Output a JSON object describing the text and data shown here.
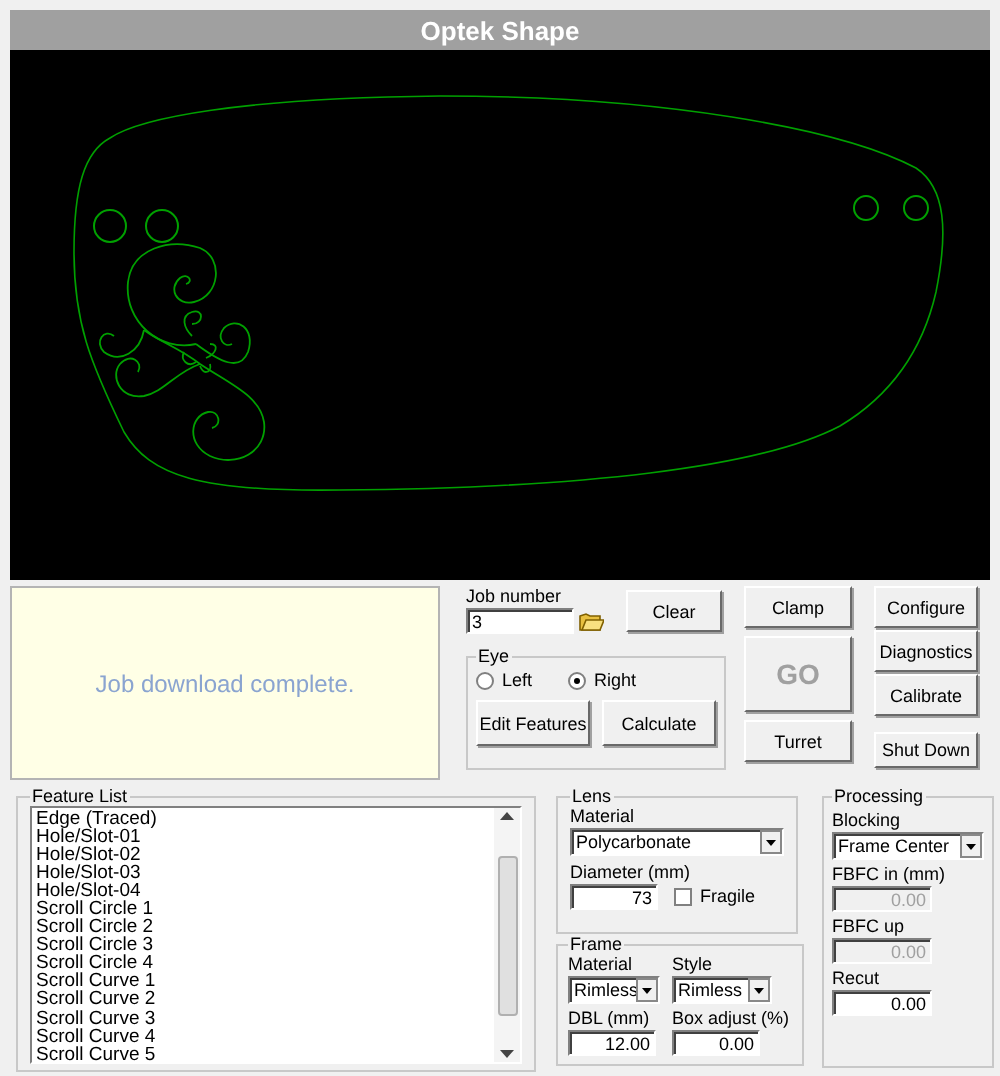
{
  "window": {
    "title": "Optek Shape"
  },
  "status_message": "Job download complete.",
  "job": {
    "label": "Job number",
    "value": "3",
    "clear_button": "Clear"
  },
  "eye": {
    "title": "Eye",
    "options": [
      {
        "label": "Left",
        "selected": false
      },
      {
        "label": "Right",
        "selected": true
      }
    ],
    "buttons": [
      "Edit Features",
      "Calculate"
    ]
  },
  "machine_buttons": [
    {
      "label": "Clamp",
      "disabled": false
    },
    {
      "label": "GO",
      "disabled": true
    },
    {
      "label": "Turret",
      "disabled": false
    }
  ],
  "system_buttons": [
    "Configure",
    "Diagnostics",
    "Calibrate",
    "Shut Down"
  ],
  "feature_list": {
    "title": "Feature List",
    "items": [
      "Edge (Traced)",
      "Hole/Slot-01",
      "Hole/Slot-02",
      "Hole/Slot-03",
      "Hole/Slot-04",
      "Scroll Circle 1",
      "Scroll Circle 2",
      "Scroll Circle 3",
      "Scroll Circle 4",
      "Scroll Curve 1",
      "Scroll Curve 2",
      "Scroll Curve 3",
      "Scroll Curve 4",
      "Scroll Curve 5"
    ]
  },
  "lens": {
    "title": "Lens",
    "material_label": "Material",
    "material": "Polycarbonate",
    "diameter_label": "Diameter (mm)",
    "diameter": "73",
    "fragile": {
      "label": "Fragile",
      "checked": false
    }
  },
  "frame": {
    "title": "Frame",
    "material_label": "Material",
    "material": "Rimless",
    "style_label": "Style",
    "style": "Rimless",
    "dbl_label": "DBL (mm)",
    "dbl": "12.00",
    "box_adjust_label": "Box adjust (%)",
    "box_adjust": "0.00"
  },
  "processing": {
    "title": "Processing",
    "fields": [
      {
        "kind": "select",
        "label": "Blocking",
        "value": "Frame Center",
        "disabled": false
      },
      {
        "kind": "input",
        "label": "FBFC in (mm)",
        "value": "0.00",
        "disabled": true
      },
      {
        "kind": "input",
        "label": "FBFC up",
        "value": "0.00",
        "disabled": true
      },
      {
        "kind": "input",
        "label": "Recut",
        "value": "0.00",
        "disabled": false
      }
    ]
  }
}
